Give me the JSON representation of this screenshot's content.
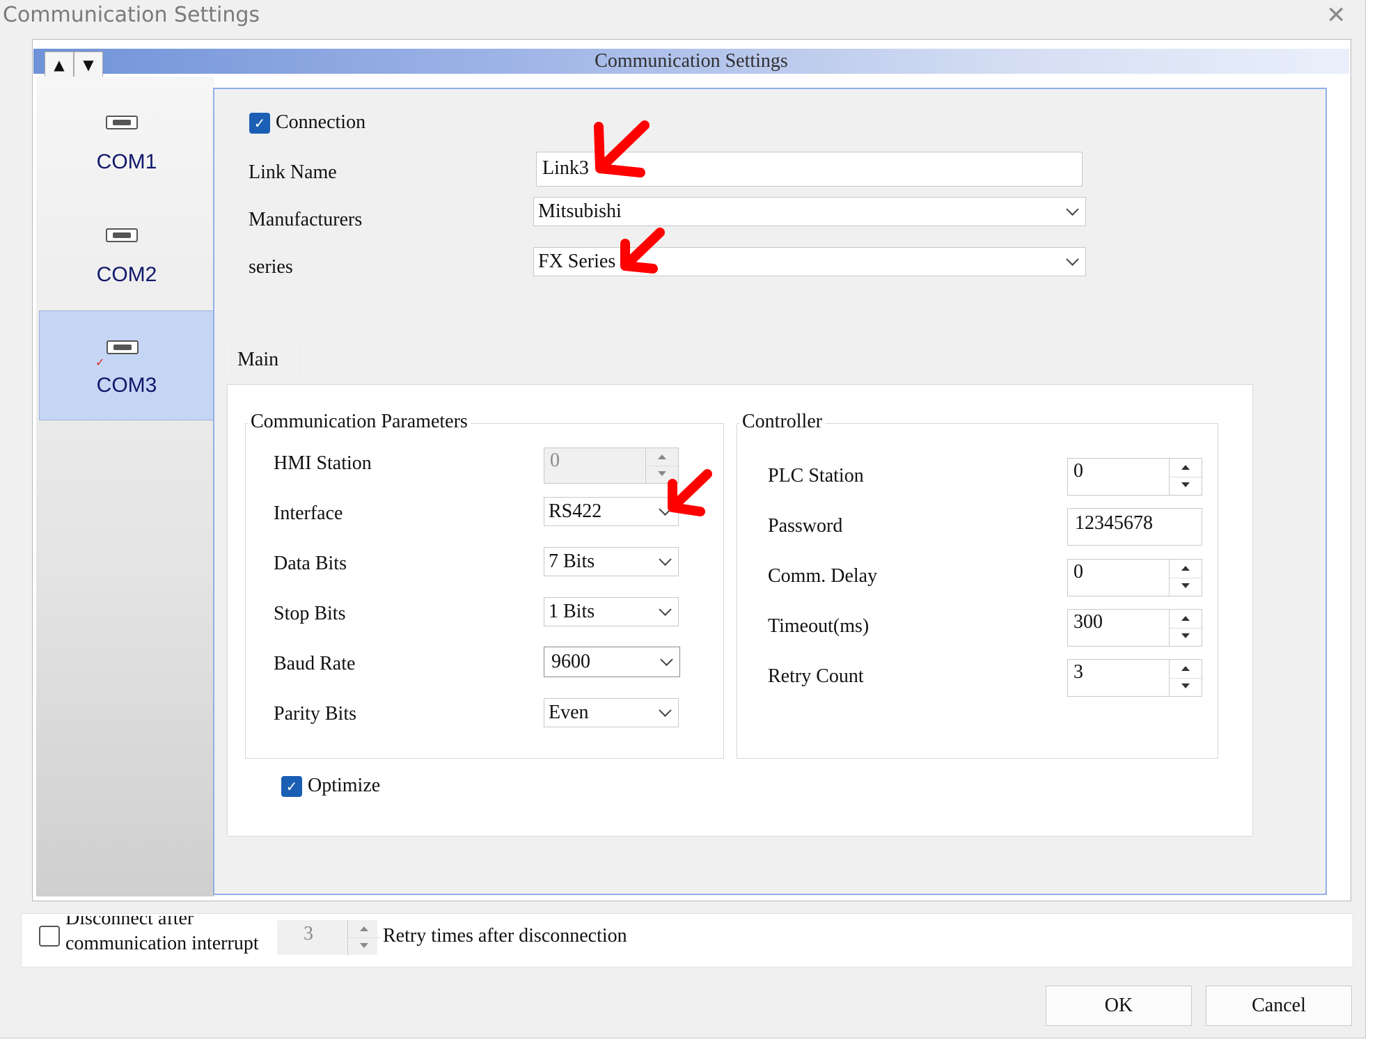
{
  "window": {
    "title": "Communication Settings",
    "close_glyph": "✕"
  },
  "header": {
    "title": "Communication Settings",
    "up_glyph": "▲",
    "down_glyph": "▼"
  },
  "sidebar": {
    "items": [
      {
        "label": "COM1",
        "icon": "serial-port-icon"
      },
      {
        "label": "COM2",
        "icon": "serial-port-icon"
      },
      {
        "label": "COM3",
        "icon": "serial-port-icon",
        "selected": true,
        "check_glyph": "✓"
      }
    ]
  },
  "connection": {
    "checkbox_label": "Connection",
    "checked": true,
    "link_name_label": "Link Name",
    "link_name_value": "Link3",
    "manufacturers_label": "Manufacturers",
    "manufacturers_value": "Mitsubishi",
    "series_label": "series",
    "series_value": "FX Series"
  },
  "tabs": {
    "main": "Main"
  },
  "comm_params": {
    "title": "Communication Parameters",
    "hmi_station_label": "HMI Station",
    "hmi_station_value": "0",
    "interface_label": "Interface",
    "interface_value": "RS422",
    "data_bits_label": "Data Bits",
    "data_bits_value": "7 Bits",
    "stop_bits_label": "Stop Bits",
    "stop_bits_value": "1 Bits",
    "baud_rate_label": "Baud Rate",
    "baud_rate_value": "9600",
    "parity_label": "Parity Bits",
    "parity_value": "Even"
  },
  "controller": {
    "title": "Controller",
    "plc_station_label": "PLC Station",
    "plc_station_value": "0",
    "password_label": "Password",
    "password_value": "12345678",
    "comm_delay_label": "Comm. Delay",
    "comm_delay_value": "0",
    "timeout_label": "Timeout(ms)",
    "timeout_value": "300",
    "retry_label": "Retry Count",
    "retry_value": "3"
  },
  "optimize": {
    "label": "Optimize",
    "checked": true,
    "check_glyph": "✓"
  },
  "bottom": {
    "disconnect_label_line1": "Disconnect after",
    "disconnect_label_line2": "communication interrupt",
    "retry_times_value": "3",
    "retry_times_label": "Retry times after disconnection"
  },
  "buttons": {
    "ok": "OK",
    "cancel": "Cancel"
  },
  "colors": {
    "accent": "#1a5fb4",
    "annotation": "#ff0000",
    "selected_bg": "#c5d6f5"
  }
}
